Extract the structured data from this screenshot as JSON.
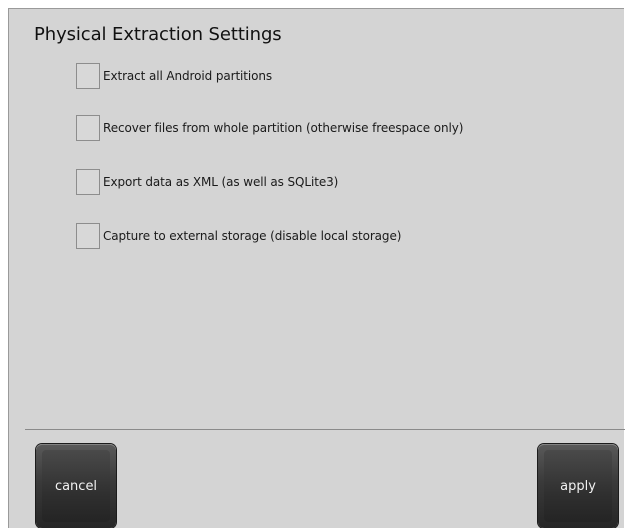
{
  "title": "Physical Extraction Settings",
  "options": [
    {
      "label": "Extract all Android partitions",
      "checked": false
    },
    {
      "label": "Recover files from whole partition (otherwise freespace only)",
      "checked": false
    },
    {
      "label": "Export data as XML (as well as SQLite3)",
      "checked": false
    },
    {
      "label": "Capture to external storage (disable local storage)",
      "checked": false
    }
  ],
  "buttons": {
    "cancel_label": "cancel",
    "apply_label": "apply"
  },
  "colors": {
    "panel_background": "#d4d4d4",
    "button_dark": "#2e2e2e",
    "button_text": "#f2f2f2"
  }
}
